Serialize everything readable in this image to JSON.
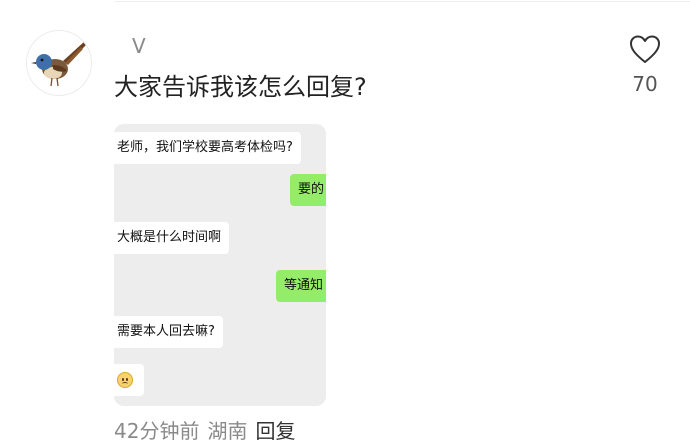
{
  "comment": {
    "username": "V",
    "text": "大家告诉我该怎么回复?",
    "likes": "70",
    "time": "42分钟前",
    "location": "湖南",
    "reply_label": "回复"
  },
  "chat_image": {
    "messages": [
      {
        "side": "left",
        "text": "老师，我们学校要高考体检吗?"
      },
      {
        "side": "right",
        "text": "要的"
      },
      {
        "side": "left",
        "text": "大概是什么时间啊"
      },
      {
        "side": "right",
        "text": "等通知"
      },
      {
        "side": "left",
        "text": "需要本人回去嘛?"
      },
      {
        "side": "left",
        "text": "",
        "emoji": "awkward-smile-emoji"
      }
    ],
    "colors": {
      "background": "#ededed",
      "left_bubble": "#ffffff",
      "right_bubble": "#95ec69"
    }
  },
  "icons": {
    "like": "heart-outline-icon",
    "avatar": "bird-avatar"
  }
}
